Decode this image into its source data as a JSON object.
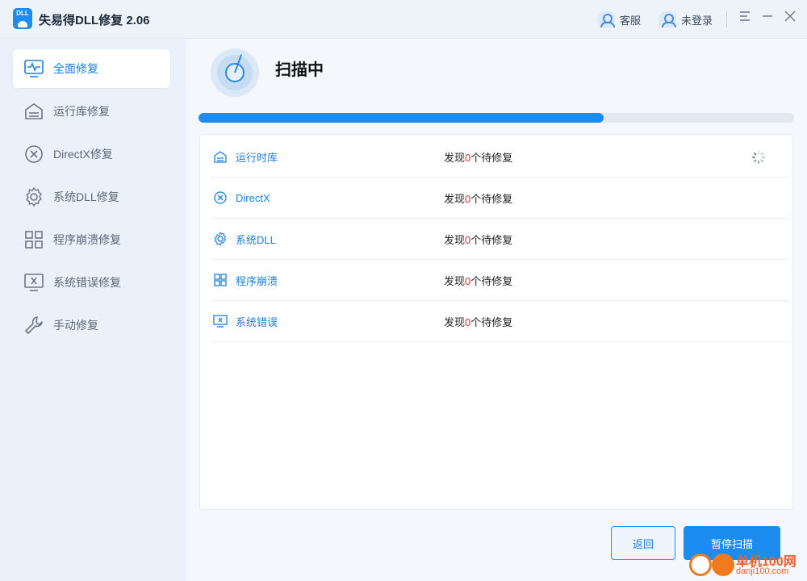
{
  "window": {
    "title": "失易得DLL修复  2.06",
    "logo_text": "DLL",
    "support_label": "客服",
    "login_label": "未登录"
  },
  "sidebar": {
    "items": [
      {
        "label": "全面修复",
        "icon": "monitor-pulse-icon",
        "active": true
      },
      {
        "label": "运行库修复",
        "icon": "library-icon",
        "active": false
      },
      {
        "label": "DirectX修复",
        "icon": "circle-x-icon",
        "active": false
      },
      {
        "label": "系统DLL修复",
        "icon": "gear-icon",
        "active": false
      },
      {
        "label": "程序崩溃修复",
        "icon": "grid-icon",
        "active": false
      },
      {
        "label": "系统错误修复",
        "icon": "monitor-x-icon",
        "active": false
      },
      {
        "label": "手动修复",
        "icon": "wrench-icon",
        "active": false
      }
    ]
  },
  "scan": {
    "title": "扫描中",
    "progress": 0.68
  },
  "results": [
    {
      "label": "运行时库",
      "icon": "library-icon",
      "prefix": "发现",
      "count": "0",
      "suffix": "个待修复",
      "loading": true
    },
    {
      "label": "DirectX",
      "icon": "circle-x-icon",
      "prefix": "发现",
      "count": "0",
      "suffix": "个待修复",
      "loading": false
    },
    {
      "label": "系统DLL",
      "icon": "gear-icon",
      "prefix": "发现",
      "count": "0",
      "suffix": "个待修复",
      "loading": false
    },
    {
      "label": "程序崩溃",
      "icon": "grid-icon",
      "prefix": "发现",
      "count": "0",
      "suffix": "个待修复",
      "loading": false
    },
    {
      "label": "系统错误",
      "icon": "monitor-x-icon",
      "prefix": "发现",
      "count": "0",
      "suffix": "个待修复",
      "loading": false
    }
  ],
  "buttons": {
    "back": "返回",
    "pause": "暂停扫描"
  },
  "watermark": {
    "main": "单机100网",
    "sub": "danji100.com"
  },
  "colors": {
    "accent": "#1c8cf0",
    "count": "#e02b2b",
    "sidebar_bg": "#eaf1fa"
  }
}
